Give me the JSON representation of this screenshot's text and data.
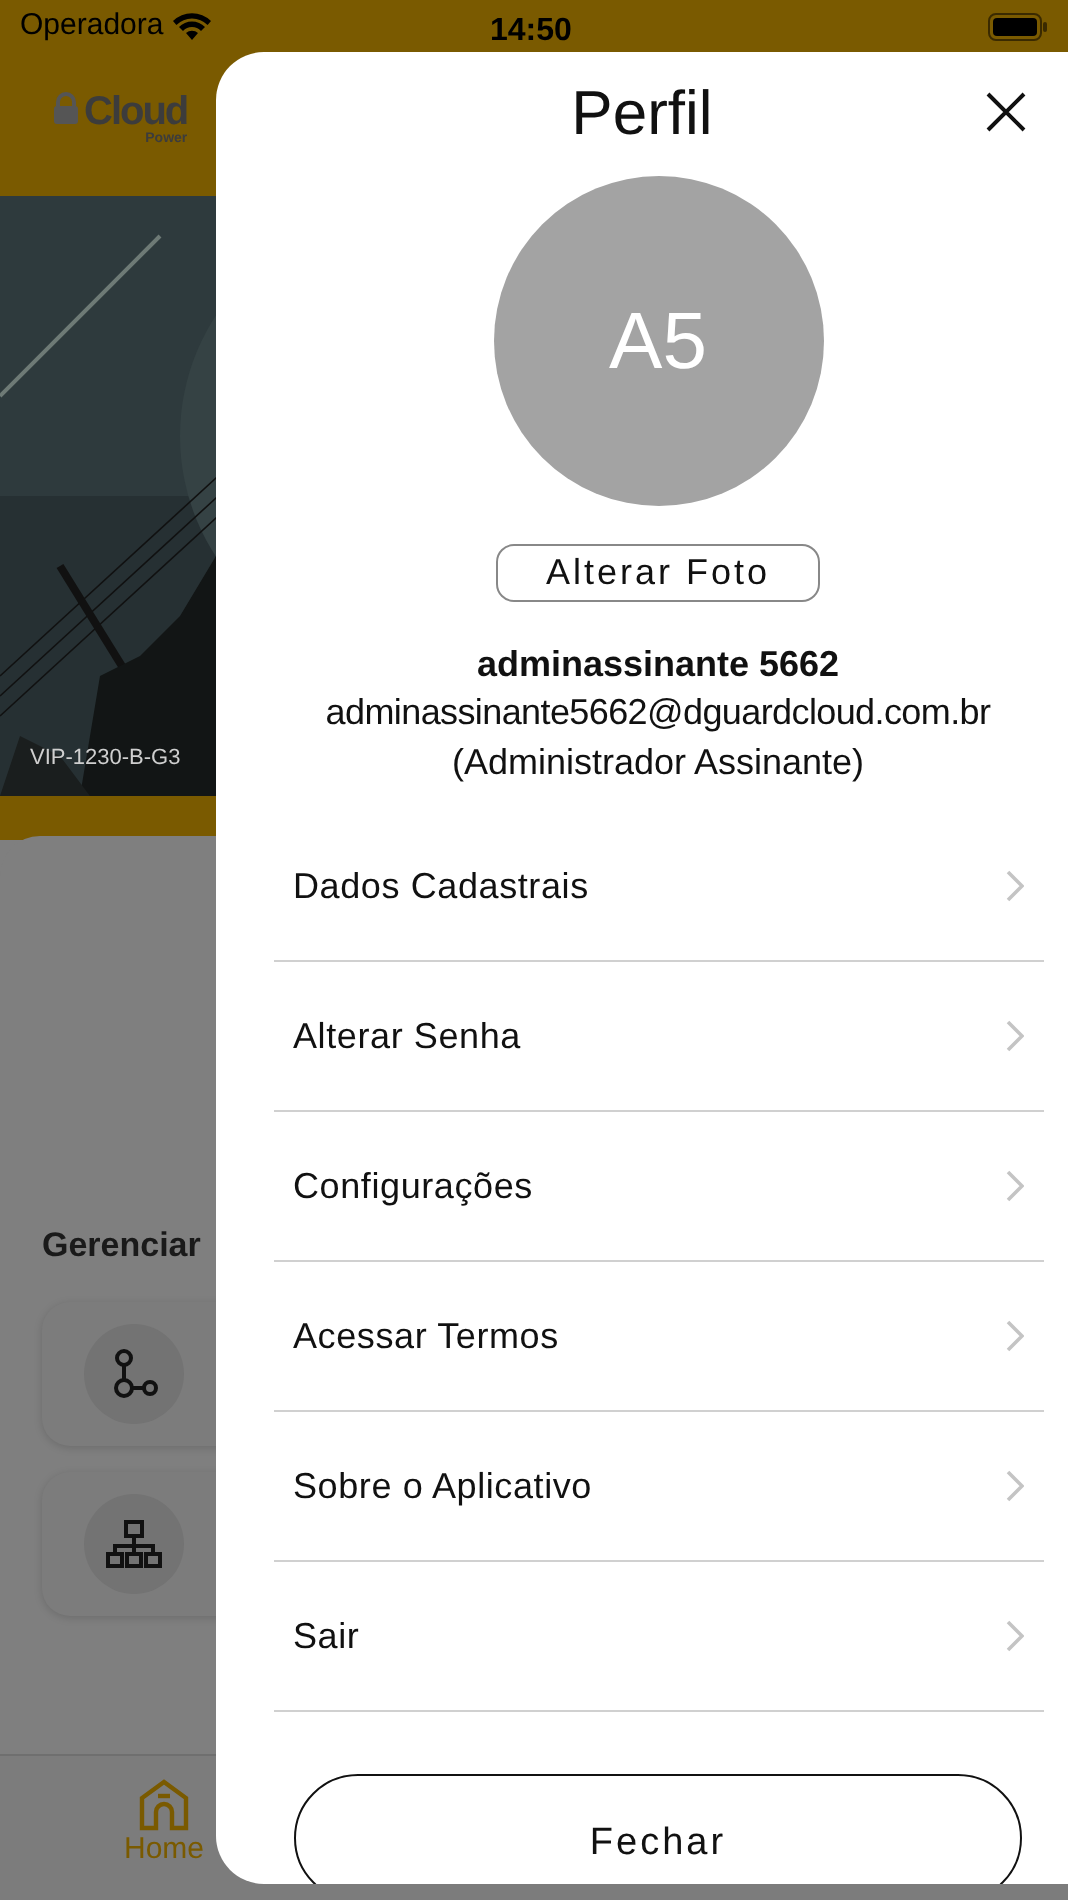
{
  "status_bar": {
    "carrier": "Operadora",
    "time": "14:50"
  },
  "background": {
    "logo": {
      "text": "Cloud",
      "subtext": "Power"
    },
    "camera_label": "VIP-1230-B-G3",
    "section_title": "Gerenciar",
    "cards": [
      {
        "kind": "network"
      },
      {
        "kind": "hierarchy"
      }
    ],
    "tab_bar": [
      {
        "label": "Home",
        "selected": true
      }
    ]
  },
  "profile_sheet": {
    "title": "Perfil",
    "avatar_initials": "A5",
    "change_photo_button": "Alterar Foto",
    "user_name": "adminassinante 5662",
    "email": "adminassinante5662@dguardcloud.com.br",
    "role": "(Administrador Assinante)",
    "menu_items": [
      {
        "label": "Dados Cadastrais"
      },
      {
        "label": "Alterar Senha"
      },
      {
        "label": "Configurações"
      },
      {
        "label": "Acessar Termos"
      },
      {
        "label": "Sobre o Aplicativo"
      },
      {
        "label": "Sair"
      }
    ],
    "close_button": "Fechar"
  }
}
